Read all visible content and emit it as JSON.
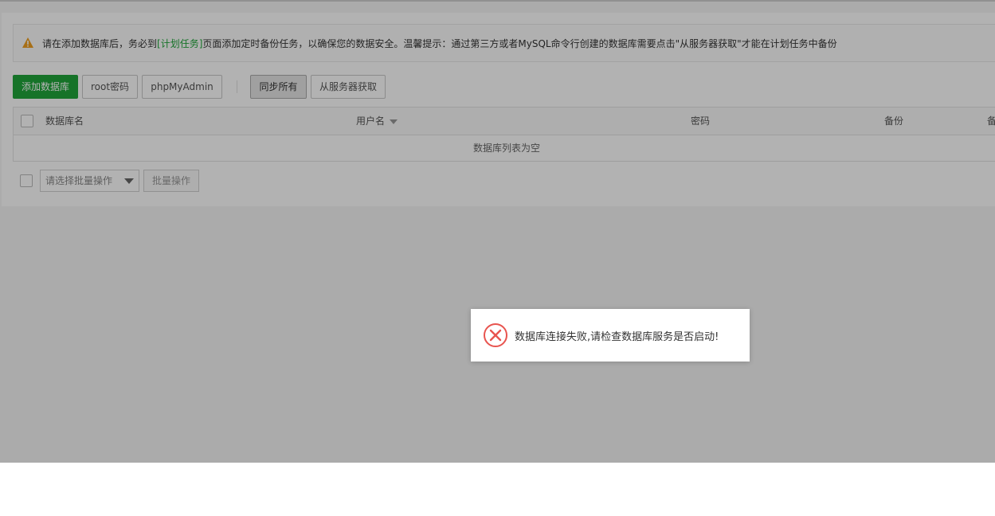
{
  "alert": {
    "text_before": "请在添加数据库后，务必到",
    "link_text": "[计划任务]",
    "text_after": "页面添加定时备份任务，以确保您的数据安全。温馨提示：通过第三方或者MySQL命令行创建的数据库需要点击\"从服务器获取\"才能在计划任务中备份",
    "icon": "warning-icon"
  },
  "toolbar": {
    "add_db": "添加数据库",
    "root_password": "root密码",
    "phpmyadmin": "phpMyAdmin",
    "sync_all": "同步所有",
    "fetch_from_server": "从服务器获取"
  },
  "table": {
    "columns": [
      "数据库名",
      "用户名",
      "密码",
      "备份",
      "备"
    ],
    "empty_text": "数据库列表为空"
  },
  "footer": {
    "batch_select_placeholder": "请选择批量操作",
    "batch_button": "批量操作"
  },
  "toast": {
    "message": "数据库连接失败,请检查数据库服务是否启动!",
    "icon": "error-circle-icon"
  },
  "colors": {
    "primary": "#20a53a",
    "error": "#e8544f",
    "warning": "#f0a020"
  }
}
